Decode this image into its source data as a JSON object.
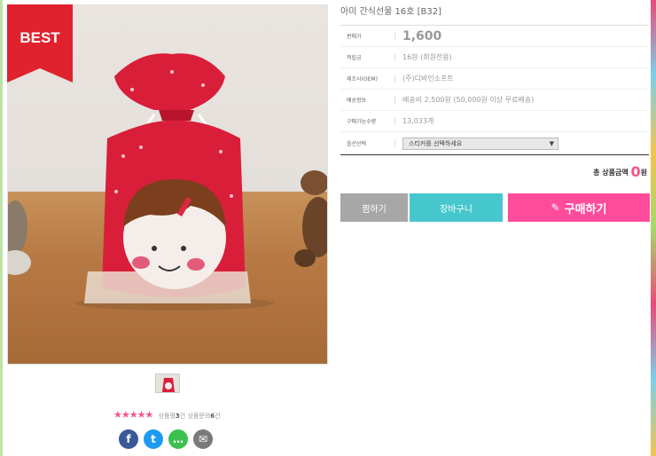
{
  "badge": {
    "best": "BEST"
  },
  "product": {
    "title": "아미 간식선물 16호 [B32]",
    "rows": [
      {
        "label": "판매가",
        "value": "1,600"
      },
      {
        "label": "적립금",
        "value": "16원 (회원전용)"
      },
      {
        "label": "제조사(OEM)",
        "value": "(주)디바인소프트"
      },
      {
        "label": "배송정보",
        "value": "배송비 2,500원 (50,000원 이상 무료배송)"
      },
      {
        "label": "구매가능수량",
        "value": "13,033개"
      },
      {
        "label": "옵션선택",
        "value": "스티커를 선택하세요"
      }
    ]
  },
  "total": {
    "label": "총 상품금액",
    "amount": "0",
    "unit": "원"
  },
  "buttons": {
    "wish": "찜하기",
    "cart": "장바구니",
    "buy": "구매하기"
  },
  "reviews": {
    "stars": "★★★★★",
    "review_label": "상품평",
    "review_count": "3",
    "review_unit": "건",
    "qna_label": "상품문의",
    "qna_count": "6",
    "qna_unit": "건"
  },
  "share": {
    "facebook": "f",
    "twitter": "t",
    "talk": "…",
    "mail": "✉"
  }
}
